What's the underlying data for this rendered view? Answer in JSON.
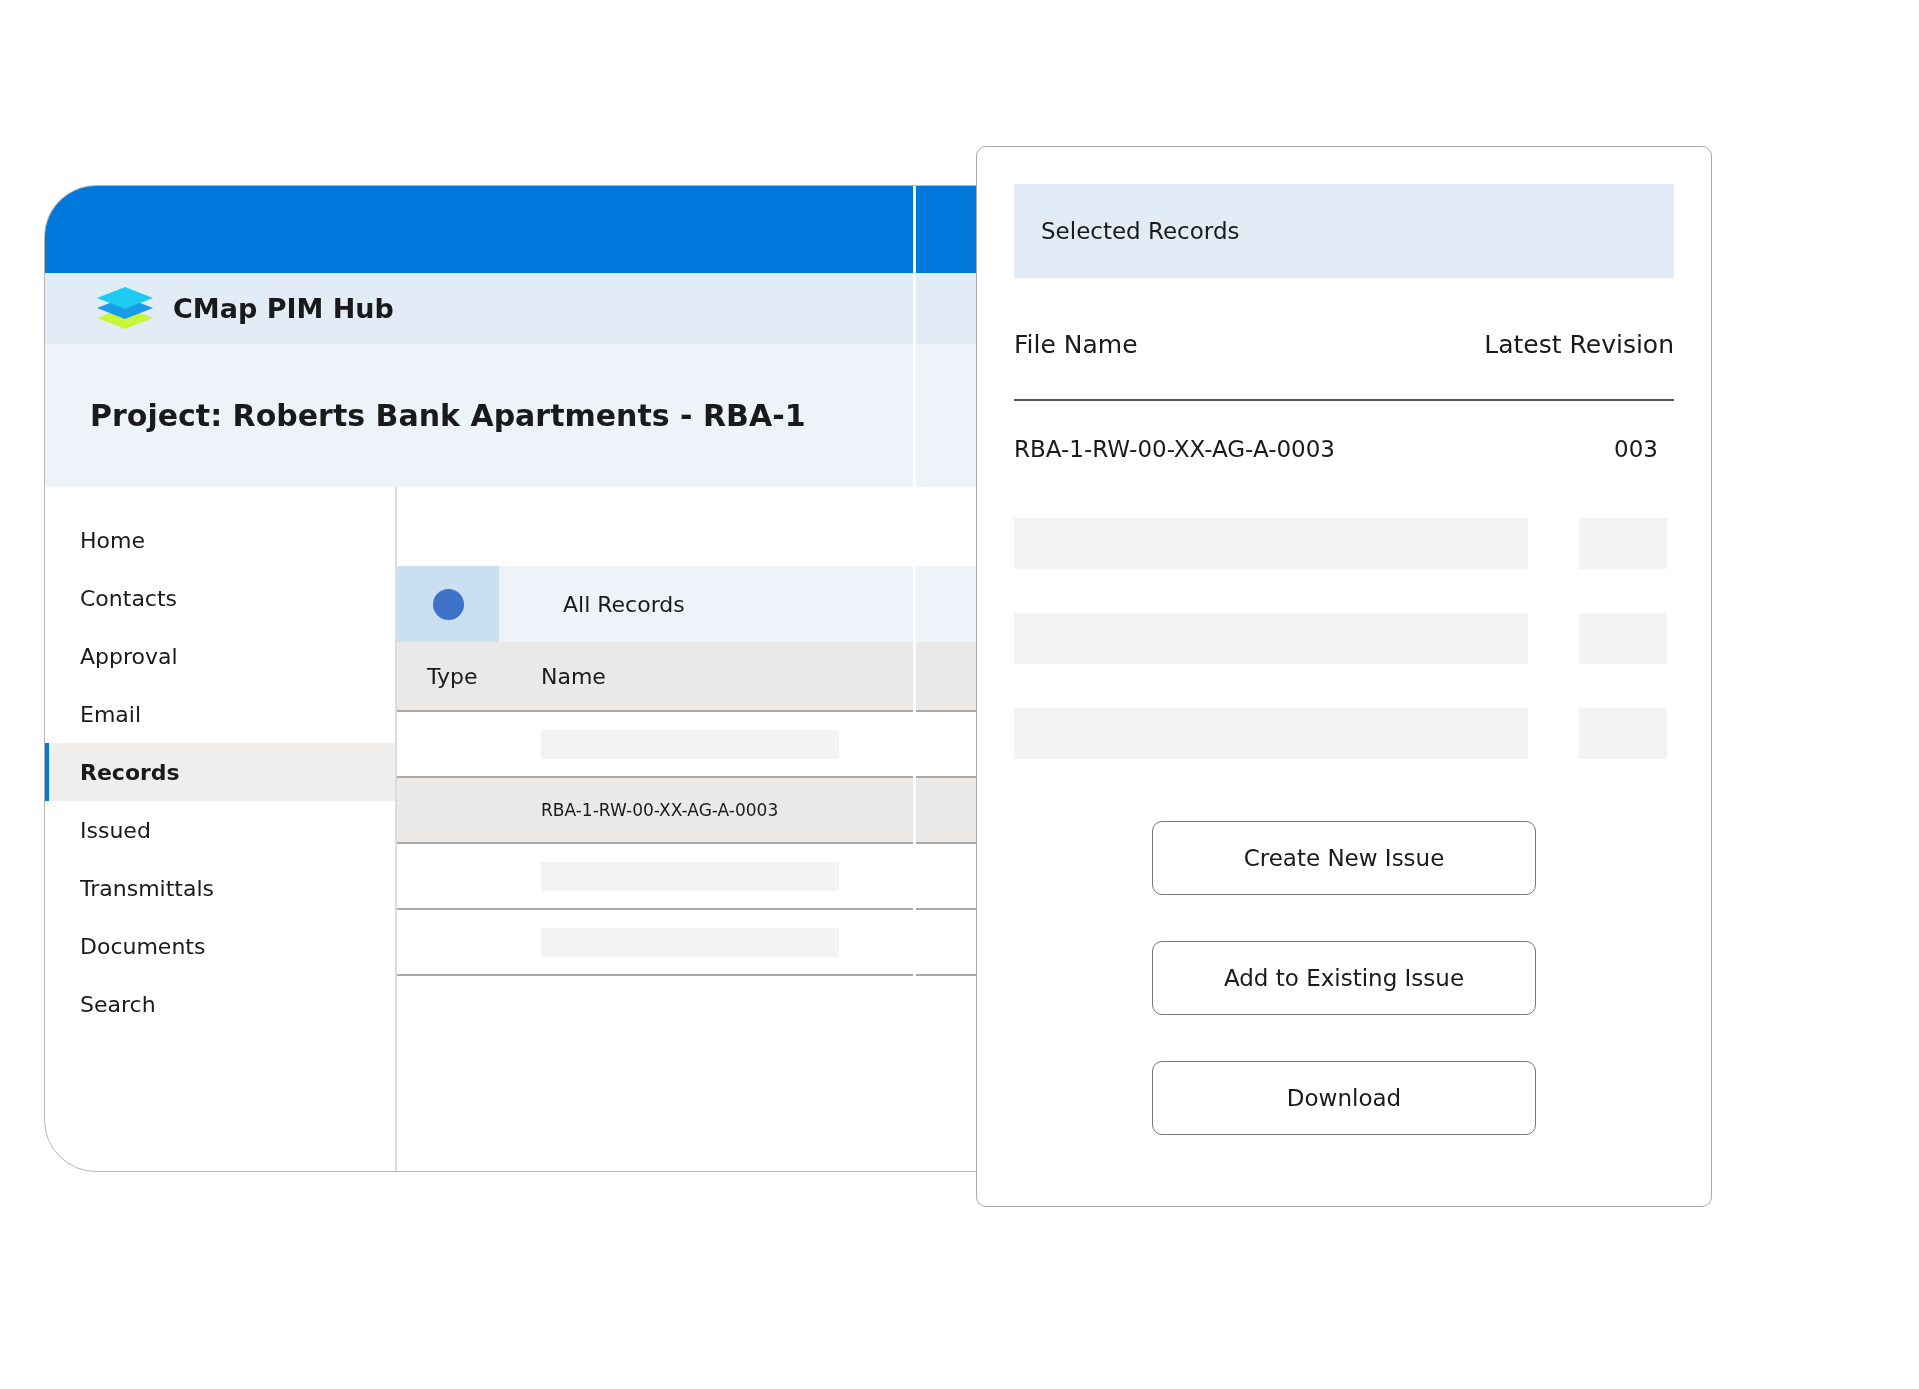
{
  "app": {
    "name": "CMap PIM Hub"
  },
  "project": {
    "title": "Project: Roberts Bank Apartments - RBA-1"
  },
  "sidebar": {
    "items": [
      {
        "label": "Home",
        "selected": false
      },
      {
        "label": "Contacts",
        "selected": false
      },
      {
        "label": "Approval",
        "selected": false
      },
      {
        "label": "Email",
        "selected": false
      },
      {
        "label": "Records",
        "selected": true
      },
      {
        "label": "Issued",
        "selected": false
      },
      {
        "label": "Transmittals",
        "selected": false
      },
      {
        "label": "Documents",
        "selected": false
      },
      {
        "label": "Search",
        "selected": false
      }
    ]
  },
  "records_tab": {
    "label": "All Records"
  },
  "table": {
    "columns": [
      "Type",
      "Name"
    ],
    "rows": [
      {
        "kind": "placeholder",
        "selected": false
      },
      {
        "kind": "text",
        "name": "RBA-1-RW-00-XX-AG-A-0003",
        "selected": true
      },
      {
        "kind": "placeholder",
        "selected": false
      },
      {
        "kind": "placeholder",
        "selected": false
      }
    ]
  },
  "selected_panel": {
    "title": "Selected Records",
    "columns": [
      "File Name",
      "Latest Revision"
    ],
    "rows": [
      {
        "kind": "text",
        "file_name": "RBA-1-RW-00-XX-AG-A-0003",
        "revision": "003"
      },
      {
        "kind": "placeholder"
      },
      {
        "kind": "placeholder"
      },
      {
        "kind": "placeholder"
      }
    ]
  },
  "buttons": [
    "Create New Issue",
    "Add to Existing Issue",
    "Download"
  ]
}
